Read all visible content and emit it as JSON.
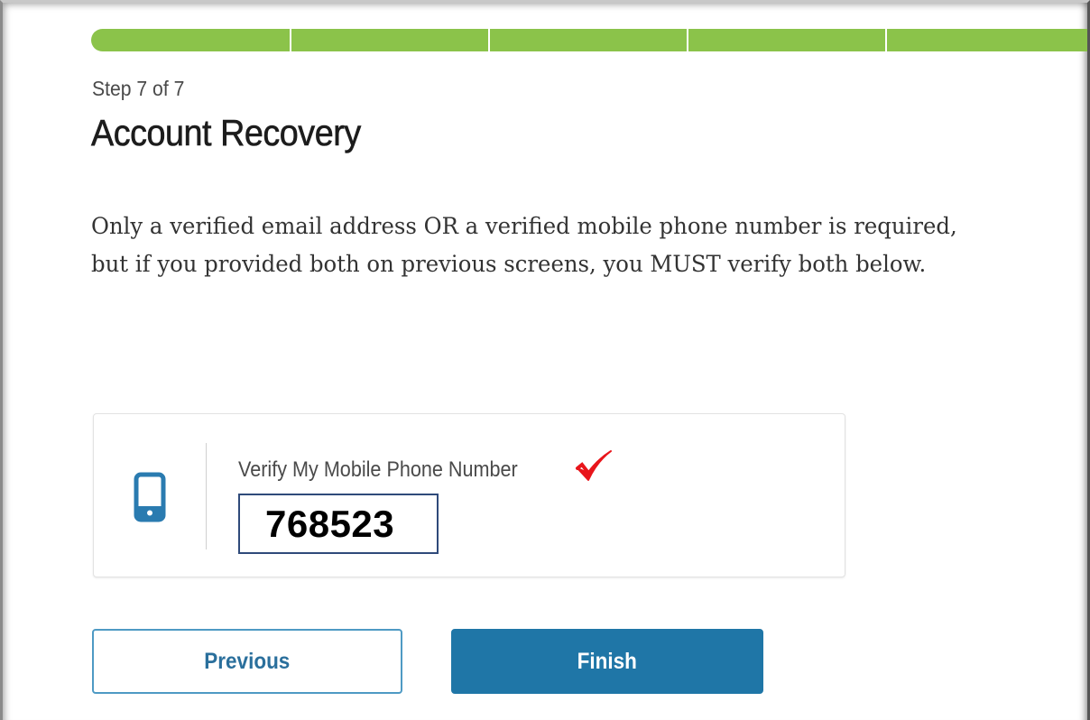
{
  "progress": {
    "steps_total": 7,
    "steps_completed": 7,
    "segment_color": "#8bc34a"
  },
  "header": {
    "step_label": "Step 7 of 7",
    "title": "Account Recovery"
  },
  "instructions": "Only a verified email address OR a verified mobile phone number is required, but if you provided both on previous screens, you MUST verify both below.",
  "verify_card": {
    "icon": "mobile-phone-icon",
    "label": "Verify My Mobile Phone Number",
    "status_icon": "checkmark-icon",
    "status_color": "#e8151b",
    "code_value": "768523"
  },
  "buttons": {
    "previous": "Previous",
    "finish": "Finish"
  },
  "colors": {
    "accent": "#1f76a7",
    "progress": "#8bc34a",
    "icon": "#2a7bb0"
  }
}
